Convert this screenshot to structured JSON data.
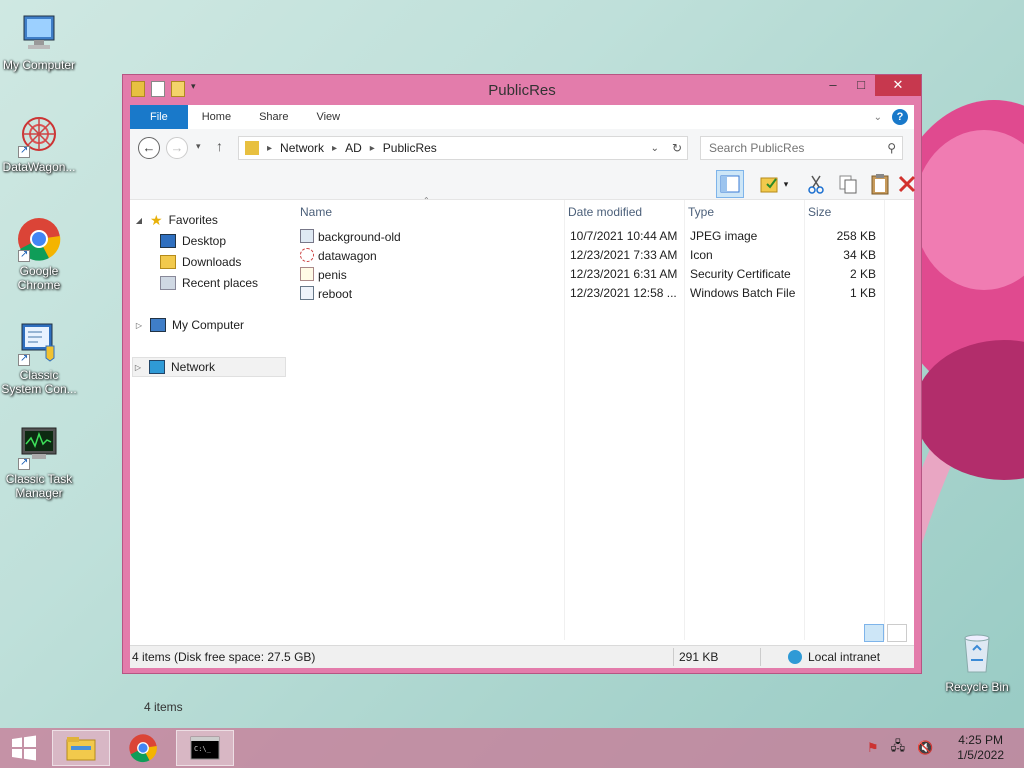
{
  "desktop": {
    "icons": [
      {
        "label": "My Computer",
        "icon": "my-computer-icon"
      },
      {
        "label": "DataWagon...",
        "icon": "datawagon-icon"
      },
      {
        "label": "Google Chrome",
        "icon": "chrome-icon"
      },
      {
        "label": "Classic System Con...",
        "icon": "control-panel-icon"
      },
      {
        "label": "Classic Task Manager",
        "icon": "task-manager-icon"
      }
    ],
    "recycle_bin": "Recycle Bin"
  },
  "window": {
    "title": "PublicRes",
    "controls": {
      "minimize": "–",
      "maximize": "□",
      "close": "✕"
    }
  },
  "ribbon": {
    "tabs": [
      "File",
      "Home",
      "Share",
      "View"
    ],
    "help": "?"
  },
  "address": {
    "path": [
      "Network",
      "AD",
      "PublicRes"
    ]
  },
  "search": {
    "placeholder": "Search PublicRes"
  },
  "nav": {
    "favorites": "Favorites",
    "favorites_items": [
      "Desktop",
      "Downloads",
      "Recent places"
    ],
    "my_computer": "My Computer",
    "network": "Network"
  },
  "columns": [
    "Name",
    "Date modified",
    "Type",
    "Size"
  ],
  "files": [
    {
      "name": "background-old",
      "date": "10/7/2021 10:44 AM",
      "type": "JPEG image",
      "size": "258 KB",
      "icon": "jpeg-file-icon"
    },
    {
      "name": "datawagon",
      "date": "12/23/2021 7:33 AM",
      "type": "Icon",
      "size": "34 KB",
      "icon": "icon-file-icon"
    },
    {
      "name": "penis",
      "date": "12/23/2021 6:31 AM",
      "type": "Security Certificate",
      "size": "2 KB",
      "icon": "certificate-file-icon"
    },
    {
      "name": "reboot",
      "date": "12/23/2021 12:58 ...",
      "type": "Windows Batch File",
      "size": "1 KB",
      "icon": "batch-file-icon"
    }
  ],
  "footer": {
    "items_count": "4 items"
  },
  "status": {
    "left": "4 items (Disk free space: 27.5 GB)",
    "size": "291 KB",
    "zone": "Local intranet"
  },
  "taskbar": {
    "time": "4:25 PM",
    "date": "1/5/2022"
  }
}
